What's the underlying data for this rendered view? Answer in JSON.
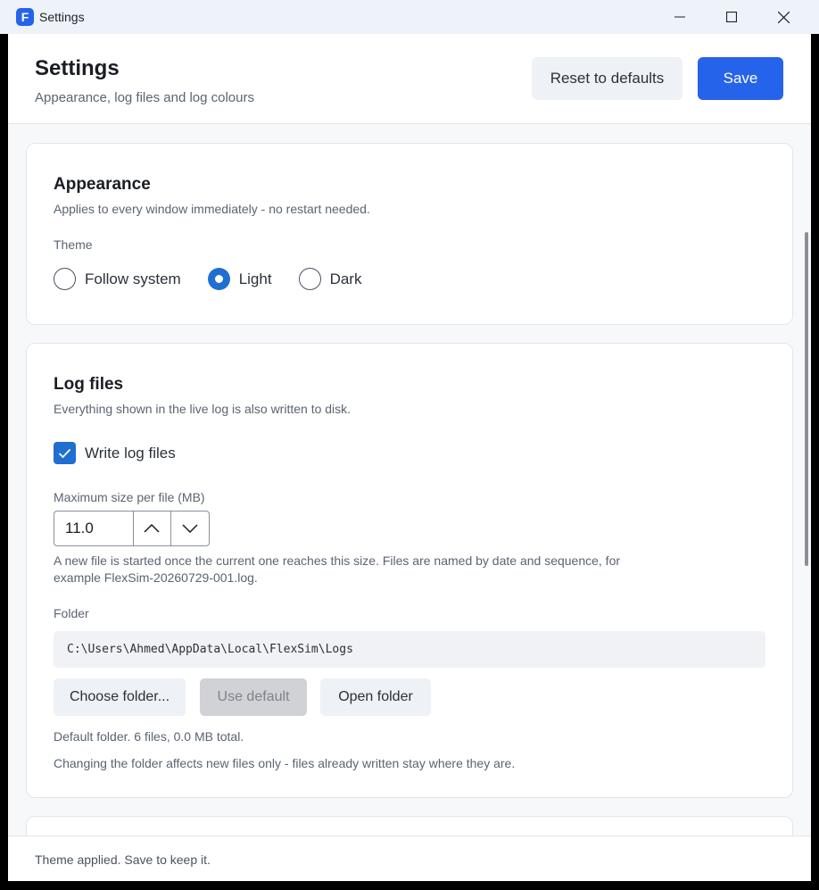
{
  "window": {
    "title": "Settings",
    "app_icon_letter": "F",
    "controls": {
      "minimize": "minimize-icon",
      "maximize": "maximize-icon",
      "close": "close-icon"
    }
  },
  "header": {
    "title": "Settings",
    "subtitle": "Appearance, log files and log colours",
    "reset_label": "Reset to defaults",
    "save_label": "Save"
  },
  "appearance": {
    "title": "Appearance",
    "description": "Applies to every window immediately - no restart needed.",
    "theme_label": "Theme",
    "options": [
      {
        "label": "Follow system",
        "checked": false
      },
      {
        "label": "Light",
        "checked": true
      },
      {
        "label": "Dark",
        "checked": false
      }
    ]
  },
  "log_files": {
    "title": "Log files",
    "description": "Everything shown in the live log is also written to disk.",
    "write_label": "Write log files",
    "write_checked": true,
    "max_size_label": "Maximum size per file (MB)",
    "max_size_value": "11.0",
    "size_hint_line1": "A new file is started once the current one reaches this size. Files are named by date and sequence, for",
    "size_hint_line2": "example FlexSim-20260729-001.log.",
    "folder_label": "Folder",
    "folder_path": "C:\\Users\\Ahmed\\AppData\\Local\\FlexSim\\Logs",
    "choose_label": "Choose folder...",
    "default_label": "Use default",
    "open_label": "Open folder",
    "folder_info": "Default folder. 6 files, 0.0 MB total.",
    "folder_note": "Changing the folder affects new files only - files already written stay where they are."
  },
  "status": {
    "text": "Theme applied. Save to keep it."
  },
  "colors": {
    "accent": "#2563eb",
    "control_blue": "#1f6fd1"
  }
}
